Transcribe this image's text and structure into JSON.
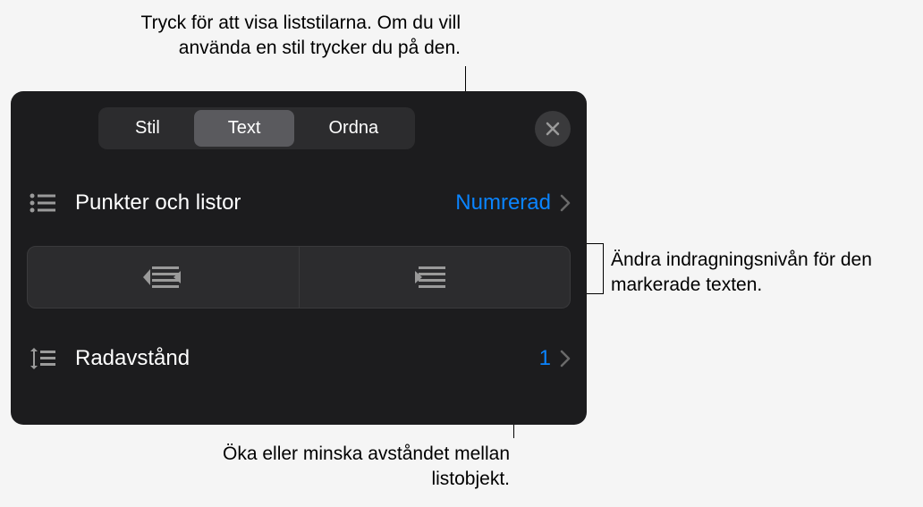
{
  "callouts": {
    "top": "Tryck för att visa liststilarna. Om du vill använda en stil trycker du på den.",
    "right": "Ändra indragningsnivån för den markerade texten.",
    "bottom": "Öka eller minska avståndet mellan listobjekt."
  },
  "segments": {
    "stil": "Stil",
    "text": "Text",
    "ordna": "Ordna"
  },
  "bullets_row": {
    "label": "Punkter och listor",
    "value": "Numrerad"
  },
  "spacing_row": {
    "label": "Radavstånd",
    "value": "1"
  }
}
